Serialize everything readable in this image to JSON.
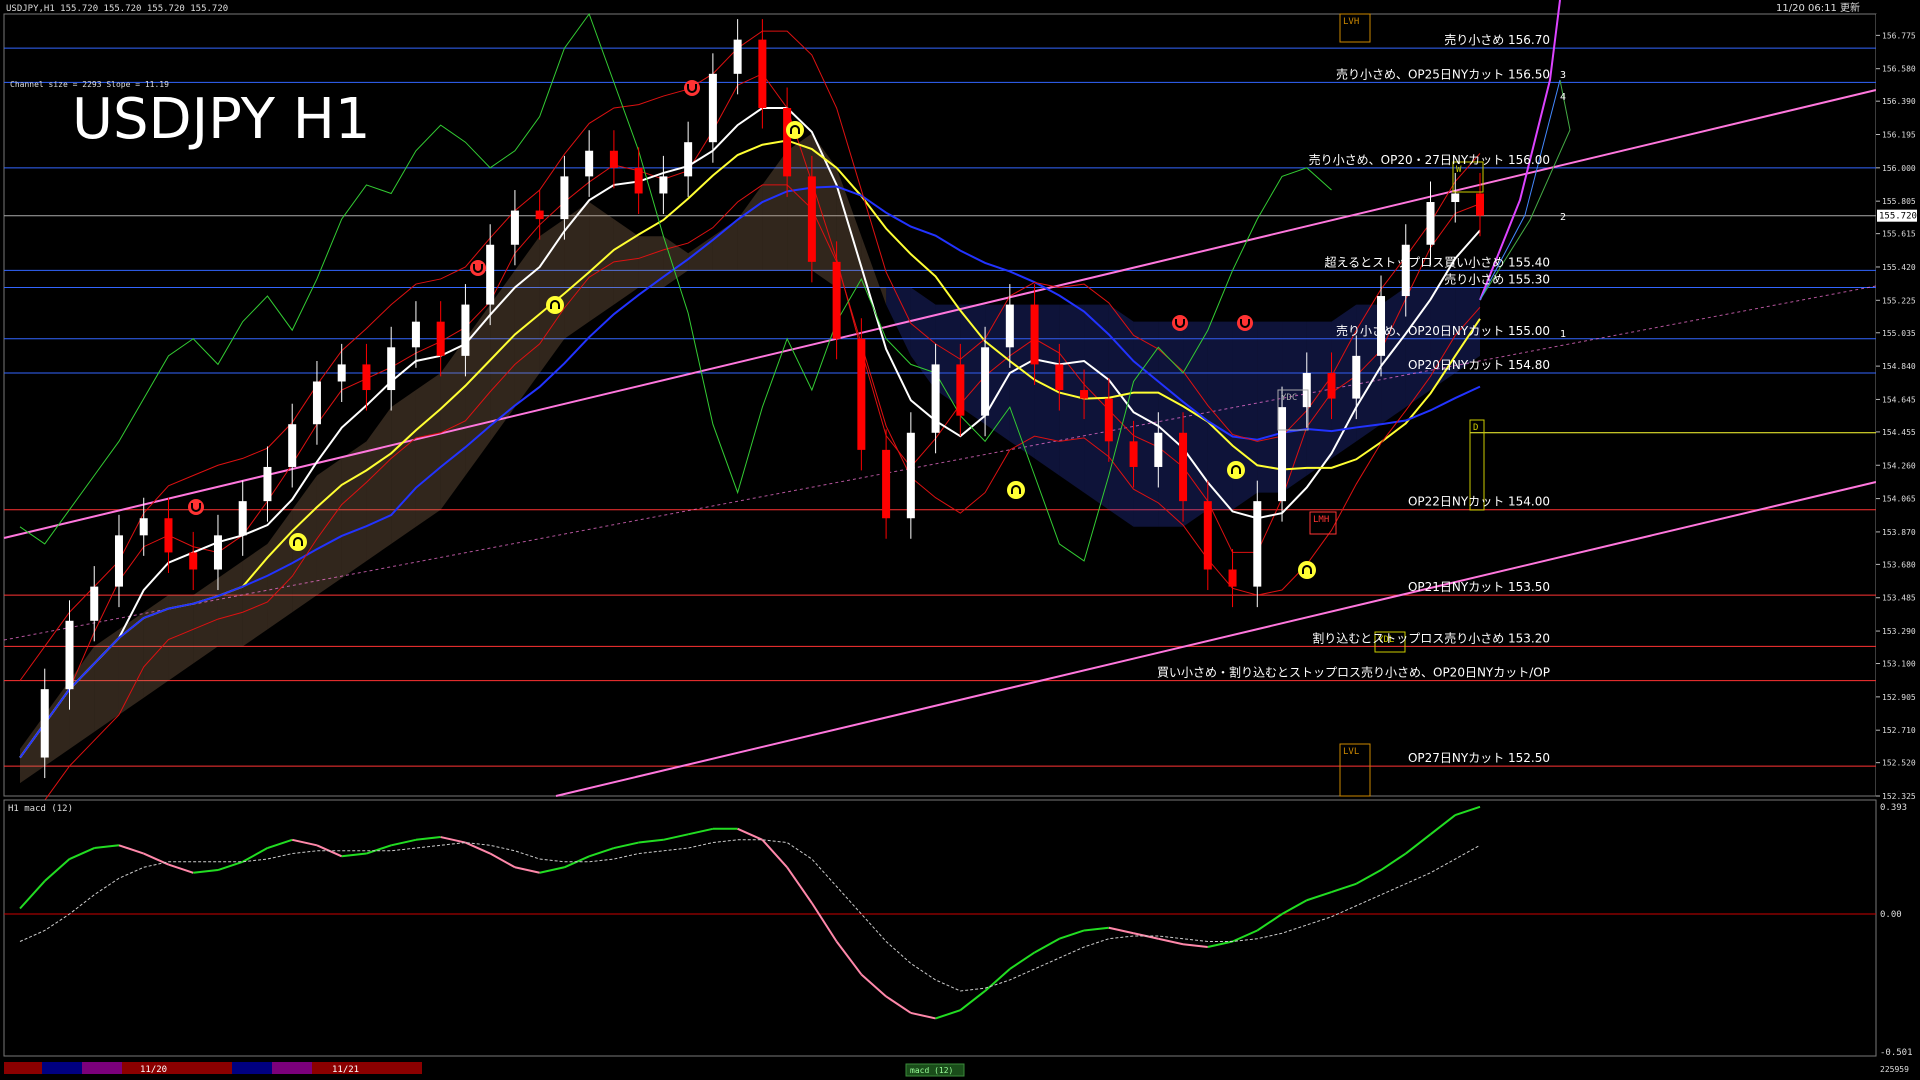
{
  "window": {
    "header_info": "USDJPY,H1  155.720 155.720 155.720 155.720",
    "timestamp": "11/20 06:11 更新"
  },
  "overlay": {
    "big_title": "USDJPY H1",
    "channel_info": "Channel size = 2293 Slope = 11.19"
  },
  "colors": {
    "background": "#000000",
    "grid": "#1e2a6a",
    "bull_candle": "#ffffff",
    "bear_candle": "#ff0000",
    "pink_line": "#ff77dd",
    "yellow_line": "#ffff33",
    "white_line": "#ffffff",
    "blue_line": "#2233ff",
    "green_line": "#33cc33",
    "red_line": "#dd1111",
    "macd_line": "#22dd22",
    "macd_neg": "#ff88aa",
    "signal_line": "#cccccc"
  },
  "axis": {
    "price_ticks": [
      "156.775",
      "156.580",
      "156.390",
      "156.195",
      "156.000",
      "155.805",
      "155.615",
      "155.420",
      "155.225",
      "155.035",
      "154.840",
      "154.645",
      "154.455",
      "154.260",
      "154.065",
      "153.870",
      "153.680",
      "153.485",
      "153.290",
      "153.100",
      "152.905",
      "152.710",
      "152.520",
      "152.325"
    ],
    "current_price": "155.720",
    "x_labels": [
      "11/20",
      "11/21"
    ],
    "bottom_tab": "macd (12)"
  },
  "price_levels": [
    {
      "price": 156.7,
      "label": "売り小さめ 156.70",
      "color": "#3366ff"
    },
    {
      "price": 156.5,
      "label": "売り小さめ、OP25日NYカット 156.50",
      "color": "#3366ff"
    },
    {
      "price": 156.0,
      "label": "売り小さめ、OP20・27日NYカット 156.00",
      "color": "#3366ff"
    },
    {
      "price": 155.4,
      "label": "超えるとストップロス買い小さめ 155.40",
      "color": "#3366ff"
    },
    {
      "price": 155.3,
      "label": "売り小さめ 155.30",
      "color": "#3366ff"
    },
    {
      "price": 155.0,
      "label": "売り小さめ、OP20日NYカット 155.00",
      "color": "#3366ff"
    },
    {
      "price": 154.8,
      "label": "OP20日NYカット 154.80",
      "color": "#3366ff"
    },
    {
      "price": 154.0,
      "label": "OP22日NYカット 154.00",
      "color": "#ff3333"
    },
    {
      "price": 153.5,
      "label": "OP21日NYカット 153.50",
      "color": "#ff3333"
    },
    {
      "price": 153.2,
      "label": "割り込むとストップロス売り小さめ 153.20",
      "color": "#ff3333"
    },
    {
      "price": 153.0,
      "label": "買い小さめ・割り込むとストップロス売り小さめ、OP20日NYカット/OP",
      "color": "#ff3333"
    },
    {
      "price": 152.5,
      "label": "OP27日NYカット 152.50",
      "color": "#ff3333"
    }
  ],
  "markers": {
    "lvh": "LVH",
    "lvl": "LVL",
    "ydc": "YDC",
    "ydl": "YDL",
    "lmh": "LMH",
    "w": "W",
    "d": "D",
    "num1": "1",
    "num2": "2",
    "num3": "3",
    "num4": "4"
  },
  "macd_panel": {
    "label": "H1  macd (12)",
    "ticks": [
      "0.393",
      "0.00",
      "-0.501"
    ],
    "corner_value": "225959"
  },
  "chart_data": {
    "type": "line",
    "title": "USDJPY H1",
    "ylim": [
      152.325,
      156.9
    ],
    "x": [
      0,
      1,
      2,
      3,
      4,
      5,
      6,
      7,
      8,
      9,
      10,
      11,
      12,
      13,
      14,
      15,
      16,
      17,
      18,
      19,
      20,
      21,
      22,
      23,
      24,
      25,
      26,
      27,
      28,
      29,
      30,
      31,
      32,
      33,
      34,
      35,
      36,
      37,
      38,
      39,
      40,
      41,
      42,
      43,
      44,
      45,
      46,
      47,
      48,
      49,
      50,
      51,
      52,
      53,
      54,
      55,
      56,
      57,
      58,
      59
    ],
    "series": [
      {
        "name": "price",
        "values": [
          152.55,
          152.95,
          153.35,
          153.55,
          153.85,
          153.95,
          153.75,
          153.65,
          153.85,
          154.05,
          154.25,
          154.5,
          154.75,
          154.85,
          154.7,
          154.95,
          155.1,
          154.9,
          155.2,
          155.55,
          155.75,
          155.7,
          155.95,
          156.1,
          156.0,
          155.85,
          155.95,
          156.15,
          156.55,
          156.75,
          156.35,
          155.95,
          155.45,
          155.0,
          154.35,
          153.95,
          154.45,
          154.85,
          154.55,
          154.95,
          155.2,
          154.85,
          154.7,
          154.65,
          154.4,
          154.25,
          154.45,
          154.05,
          153.65,
          153.55,
          154.05,
          154.6,
          154.8,
          154.65,
          154.9,
          155.25,
          155.55,
          155.8,
          155.85,
          155.72
        ]
      },
      {
        "name": "macd",
        "values": [
          0.02,
          0.12,
          0.2,
          0.24,
          0.25,
          0.22,
          0.18,
          0.15,
          0.16,
          0.19,
          0.24,
          0.27,
          0.25,
          0.21,
          0.22,
          0.25,
          0.27,
          0.28,
          0.26,
          0.22,
          0.17,
          0.15,
          0.17,
          0.21,
          0.24,
          0.26,
          0.27,
          0.29,
          0.31,
          0.31,
          0.27,
          0.17,
          0.04,
          -0.1,
          -0.22,
          -0.3,
          -0.36,
          -0.38,
          -0.35,
          -0.28,
          -0.2,
          -0.14,
          -0.09,
          -0.06,
          -0.05,
          -0.07,
          -0.09,
          -0.11,
          -0.12,
          -0.1,
          -0.06,
          0.0,
          0.05,
          0.08,
          0.11,
          0.16,
          0.22,
          0.29,
          0.36,
          0.39
        ]
      },
      {
        "name": "signal",
        "values": [
          -0.1,
          -0.06,
          0.0,
          0.07,
          0.13,
          0.17,
          0.19,
          0.19,
          0.19,
          0.19,
          0.2,
          0.22,
          0.23,
          0.23,
          0.23,
          0.23,
          0.24,
          0.25,
          0.26,
          0.25,
          0.23,
          0.2,
          0.19,
          0.19,
          0.2,
          0.22,
          0.23,
          0.24,
          0.26,
          0.27,
          0.27,
          0.26,
          0.2,
          0.1,
          0.0,
          -0.1,
          -0.18,
          -0.24,
          -0.28,
          -0.27,
          -0.24,
          -0.2,
          -0.16,
          -0.12,
          -0.09,
          -0.08,
          -0.08,
          -0.09,
          -0.1,
          -0.1,
          -0.09,
          -0.07,
          -0.04,
          -0.01,
          0.03,
          0.07,
          0.11,
          0.15,
          0.2,
          0.25
        ]
      }
    ]
  }
}
